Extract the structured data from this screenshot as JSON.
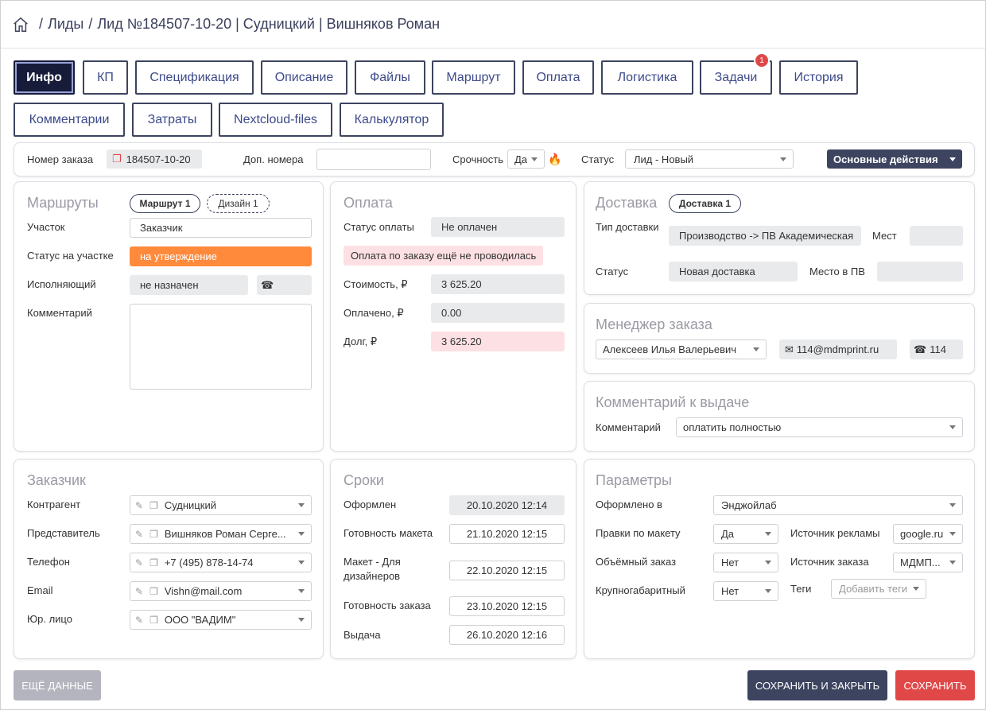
{
  "breadcrumb": {
    "parts": [
      "Лиды",
      "Лид №184507-10-20 | Судницкий | Вишняков Роман"
    ]
  },
  "tabs": [
    {
      "label": "Инфо",
      "active": true
    },
    {
      "label": "КП"
    },
    {
      "label": "Спецификация"
    },
    {
      "label": "Описание"
    },
    {
      "label": "Файлы"
    },
    {
      "label": "Маршрут"
    },
    {
      "label": "Оплата"
    },
    {
      "label": "Логистика"
    },
    {
      "label": "Задачи",
      "badge": "1"
    },
    {
      "label": "История"
    },
    {
      "label": "Комментарии"
    },
    {
      "label": "Затраты"
    },
    {
      "label": "Nextcloud-files"
    },
    {
      "label": "Калькулятор"
    }
  ],
  "topbar": {
    "order_number_label": "Номер заказа",
    "order_number": "184507-10-20",
    "extra_numbers_label": "Доп. номера",
    "extra_numbers": "",
    "urgency_label": "Срочность",
    "urgency": "Да",
    "status_label": "Статус",
    "status": "Лид - Новый",
    "main_actions": "Основные действия"
  },
  "routes": {
    "title": "Маршруты",
    "route1": "Маршрут 1",
    "design1": "Дизайн 1",
    "section_label": "Участок",
    "section": "Заказчик",
    "section_status_label": "Статус на участке",
    "section_status": "на утверждение",
    "executor_label": "Исполняющий",
    "executor": "не назначен",
    "comment_label": "Комментарий",
    "comment": ""
  },
  "payment": {
    "title": "Оплата",
    "status_label": "Статус оплаты",
    "status": "Не оплачен",
    "notice": "Оплата по заказу ещё не проводилась",
    "cost_label": "Стоимость, ₽",
    "cost": "3 625.20",
    "paid_label": "Оплачено, ₽",
    "paid": "0.00",
    "debt_label": "Долг, ₽",
    "debt": "3 625.20"
  },
  "delivery": {
    "title": "Доставка",
    "delivery1": "Доставка 1",
    "type_label": "Тип доставки",
    "type": "Производство -> ПВ Академическая",
    "places_label": "Мест",
    "places": "",
    "status_label": "Статус",
    "status": "Новая доставка",
    "pickup_place_label": "Место в ПВ",
    "pickup_place": ""
  },
  "manager": {
    "title": "Менеджер заказа",
    "name": "Алексеев Илья Валерьевич",
    "email": "114@mdmprint.ru",
    "phone": "114"
  },
  "issue_comment": {
    "title": "Комментарий к выдаче",
    "comment_label": "Комментарий",
    "comment": "оплатить полностью"
  },
  "customer": {
    "title": "Заказчик",
    "counterparty_label": "Контрагент",
    "counterparty": "Судницкий",
    "representative_label": "Представитель",
    "representative": "Вишняков Роман Серге...",
    "phone_label": "Телефон",
    "phone": "+7 (495) 878-14-74",
    "email_label": "Email",
    "email": "Vishn@mail.com",
    "legal_label": "Юр. лицо",
    "legal": "ООО \"ВАДИМ\""
  },
  "deadlines": {
    "title": "Сроки",
    "created_label": "Оформлен",
    "created": "20.10.2020 12:14",
    "layout_ready_label": "Готовность макета",
    "layout_ready": "21.10.2020 12:15",
    "layout_designers_label": "Макет - Для дизайнеров",
    "layout_designers": "22.10.2020 12:15",
    "order_ready_label": "Готовность заказа",
    "order_ready": "23.10.2020 12:15",
    "issue_label": "Выдача",
    "issue": "26.10.2020 12:16"
  },
  "params": {
    "title": "Параметры",
    "created_in_label": "Оформлено в",
    "created_in": "Энджойлаб",
    "edits_label": "Правки по макету",
    "edits": "Да",
    "ad_source_label": "Источник рекламы",
    "ad_source": "google.ru",
    "bulk_label": "Объёмный заказ",
    "bulk": "Нет",
    "order_source_label": "Источник заказа",
    "order_source": "МДМП...",
    "oversize_label": "Крупногабаритный",
    "oversize": "Нет",
    "tags_label": "Теги",
    "tags_placeholder": "Добавить теги"
  },
  "footer": {
    "more": "ЕЩЁ ДАННЫЕ",
    "save_close": "СОХРАНИТЬ И ЗАКРЫТЬ",
    "save": "СОХРАНИТЬ"
  }
}
